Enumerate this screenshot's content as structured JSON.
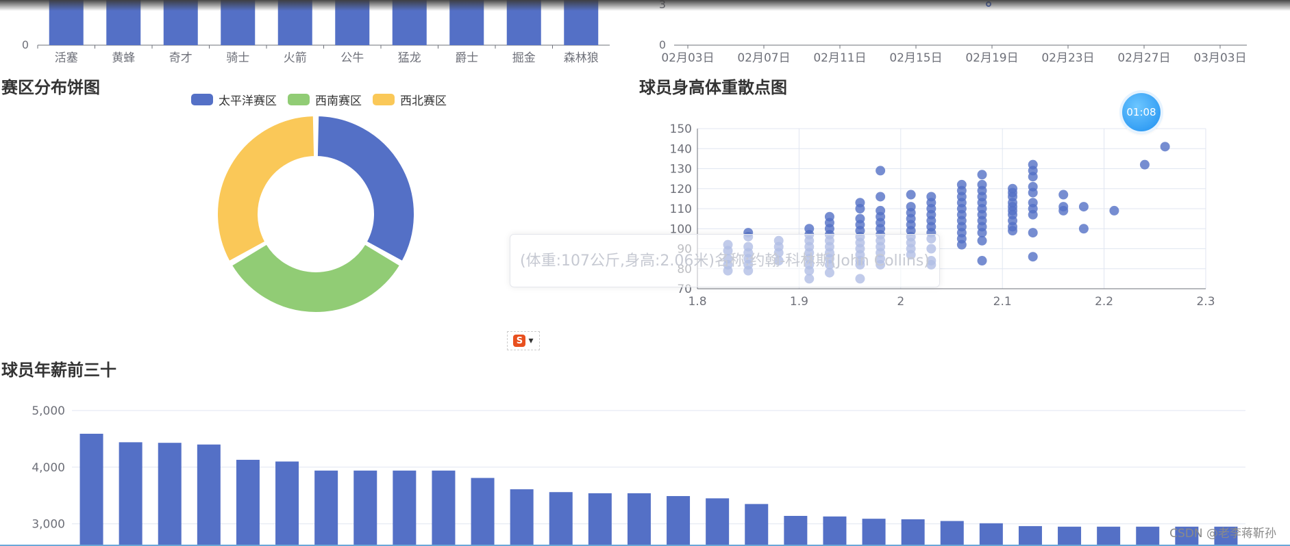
{
  "colors": {
    "blue": "#5470c6",
    "green": "#91cc75",
    "yellow": "#fac858",
    "axis": "#6e7079",
    "grid": "#e0e6f1"
  },
  "charts": {
    "team_bar": {
      "title": ""
    },
    "timeline": {
      "title": ""
    },
    "pie": {
      "title": "赛区分布饼图"
    },
    "scatter": {
      "title": "球员身高体重散点图"
    },
    "salary": {
      "title": "球员年薪前三十"
    }
  },
  "chart_data": [
    {
      "type": "bar",
      "categories": [
        "活塞",
        "黄蜂",
        "奇才",
        "骑士",
        "火箭",
        "公牛",
        "猛龙",
        "爵士",
        "掘金",
        "森林狼"
      ],
      "visible_y_ticks": [
        0
      ]
    },
    {
      "type": "line",
      "x_tick_labels": [
        "02月03日",
        "02月07日",
        "02月11日",
        "02月15日",
        "02月19日",
        "02月23日",
        "02月27日",
        "03月03日"
      ],
      "visible_y_ticks": [
        0,
        3
      ]
    },
    {
      "type": "pie",
      "title": "赛区分布饼图",
      "legend": [
        "太平洋赛区",
        "西南赛区",
        "西北赛区"
      ],
      "legend_position": "top-center",
      "values": [
        5,
        5,
        5
      ],
      "colors": [
        "#5470c6",
        "#91cc75",
        "#fac858"
      ]
    },
    {
      "type": "scatter",
      "title": "球员身高体重散点图",
      "xlim": [
        1.8,
        2.3
      ],
      "ylim": [
        70,
        150
      ],
      "x_ticks": [
        "1.8",
        "1.9",
        "2",
        "2.1",
        "2.2",
        "2.3"
      ],
      "y_ticks": [
        "70",
        "80",
        "90",
        "100",
        "110",
        "120",
        "130",
        "140",
        "150"
      ],
      "grid": true,
      "points": [
        [
          1.83,
          92
        ],
        [
          1.83,
          89
        ],
        [
          1.83,
          85
        ],
        [
          1.83,
          82
        ],
        [
          1.83,
          79
        ],
        [
          1.85,
          98
        ],
        [
          1.85,
          96
        ],
        [
          1.85,
          91
        ],
        [
          1.85,
          88
        ],
        [
          1.85,
          85
        ],
        [
          1.85,
          82
        ],
        [
          1.85,
          79
        ],
        [
          1.88,
          94
        ],
        [
          1.88,
          91
        ],
        [
          1.88,
          88
        ],
        [
          1.88,
          84
        ],
        [
          1.91,
          100
        ],
        [
          1.91,
          97
        ],
        [
          1.91,
          94
        ],
        [
          1.91,
          91
        ],
        [
          1.91,
          88
        ],
        [
          1.91,
          85
        ],
        [
          1.91,
          82
        ],
        [
          1.91,
          79
        ],
        [
          1.91,
          75
        ],
        [
          1.93,
          106
        ],
        [
          1.93,
          103
        ],
        [
          1.93,
          100
        ],
        [
          1.93,
          97
        ],
        [
          1.93,
          94
        ],
        [
          1.93,
          91
        ],
        [
          1.93,
          88
        ],
        [
          1.93,
          85
        ],
        [
          1.93,
          82
        ],
        [
          1.93,
          78
        ],
        [
          1.96,
          113
        ],
        [
          1.96,
          110
        ],
        [
          1.96,
          105
        ],
        [
          1.96,
          102
        ],
        [
          1.96,
          99
        ],
        [
          1.96,
          96
        ],
        [
          1.96,
          93
        ],
        [
          1.96,
          90
        ],
        [
          1.96,
          87
        ],
        [
          1.96,
          84
        ],
        [
          1.96,
          82
        ],
        [
          1.96,
          75
        ],
        [
          1.98,
          129
        ],
        [
          1.98,
          116
        ],
        [
          1.98,
          109
        ],
        [
          1.98,
          106
        ],
        [
          1.98,
          103
        ],
        [
          1.98,
          100
        ],
        [
          1.98,
          97
        ],
        [
          1.98,
          94
        ],
        [
          1.98,
          91
        ],
        [
          1.98,
          88
        ],
        [
          1.98,
          85
        ],
        [
          1.98,
          82
        ],
        [
          2.01,
          117
        ],
        [
          2.01,
          111
        ],
        [
          2.01,
          108
        ],
        [
          2.01,
          105
        ],
        [
          2.01,
          102
        ],
        [
          2.01,
          99
        ],
        [
          2.01,
          96
        ],
        [
          2.01,
          93
        ],
        [
          2.01,
          90
        ],
        [
          2.01,
          87
        ],
        [
          2.03,
          116
        ],
        [
          2.03,
          113
        ],
        [
          2.03,
          110
        ],
        [
          2.03,
          107
        ],
        [
          2.03,
          104
        ],
        [
          2.03,
          101
        ],
        [
          2.03,
          98
        ],
        [
          2.03,
          95
        ],
        [
          2.03,
          90
        ],
        [
          2.03,
          84
        ],
        [
          2.03,
          82
        ],
        [
          2.06,
          122
        ],
        [
          2.06,
          119
        ],
        [
          2.06,
          116
        ],
        [
          2.06,
          113
        ],
        [
          2.06,
          110
        ],
        [
          2.06,
          107
        ],
        [
          2.06,
          104
        ],
        [
          2.06,
          101
        ],
        [
          2.06,
          98
        ],
        [
          2.06,
          95
        ],
        [
          2.06,
          92
        ],
        [
          2.08,
          127
        ],
        [
          2.08,
          122
        ],
        [
          2.08,
          119
        ],
        [
          2.08,
          116
        ],
        [
          2.08,
          113
        ],
        [
          2.08,
          110
        ],
        [
          2.08,
          107
        ],
        [
          2.08,
          104
        ],
        [
          2.08,
          101
        ],
        [
          2.08,
          98
        ],
        [
          2.08,
          94
        ],
        [
          2.08,
          84
        ],
        [
          2.11,
          120
        ],
        [
          2.11,
          118
        ],
        [
          2.11,
          116
        ],
        [
          2.11,
          113
        ],
        [
          2.11,
          111
        ],
        [
          2.11,
          109
        ],
        [
          2.11,
          107
        ],
        [
          2.11,
          104
        ],
        [
          2.11,
          101
        ],
        [
          2.11,
          99
        ],
        [
          2.13,
          132
        ],
        [
          2.13,
          129
        ],
        [
          2.13,
          126
        ],
        [
          2.13,
          121
        ],
        [
          2.13,
          118
        ],
        [
          2.13,
          113
        ],
        [
          2.13,
          110
        ],
        [
          2.13,
          107
        ],
        [
          2.13,
          98
        ],
        [
          2.13,
          86
        ],
        [
          2.16,
          117
        ],
        [
          2.16,
          111
        ],
        [
          2.16,
          109
        ],
        [
          2.18,
          111
        ],
        [
          2.18,
          100
        ],
        [
          2.21,
          109
        ],
        [
          2.24,
          132
        ],
        [
          2.26,
          141
        ]
      ]
    },
    {
      "type": "bar",
      "title": "球员年薪前三十",
      "y_ticks": [
        "5,000",
        "4,000",
        "3,000"
      ],
      "values": [
        4590,
        4440,
        4430,
        4400,
        4130,
        4100,
        3940,
        3940,
        3940,
        3940,
        3810,
        3610,
        3560,
        3540,
        3540,
        3490,
        3450,
        3350,
        3140,
        3130,
        3090,
        3080,
        3050,
        3010,
        2960,
        2950,
        2950,
        2950,
        2950,
        2950
      ]
    }
  ],
  "tooltip": {
    "text": "(体重:107公斤,身高:2.06米)名称:约翰-科林斯(John Collins)"
  },
  "timer": {
    "text": "01:08"
  },
  "ime": {
    "logo": "S",
    "arrow": "▾"
  },
  "watermark": {
    "text": "CSDN @老李蒋靳孙"
  }
}
